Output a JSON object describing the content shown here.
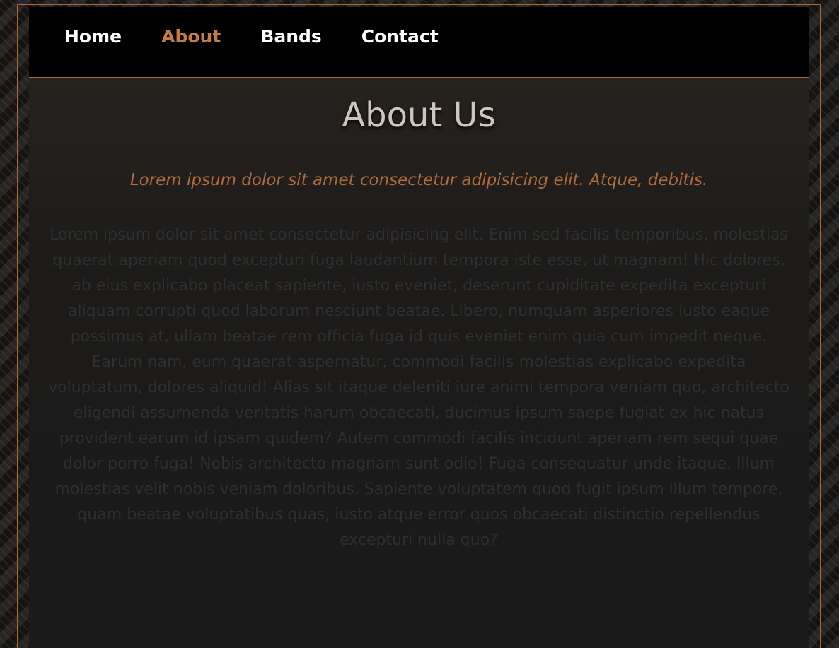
{
  "nav": {
    "items": [
      {
        "label": "Home",
        "active": false
      },
      {
        "label": "About",
        "active": true
      },
      {
        "label": "Bands",
        "active": false
      },
      {
        "label": "Contact",
        "active": false
      }
    ]
  },
  "main": {
    "title": "About Us",
    "lead": "Lorem ipsum dolor sit amet consectetur adipisicing elit. Atque, debitis.",
    "body": "Lorem ipsum dolor sit amet consectetur adipisicing elit. Enim sed facilis temporibus, molestias quaerat aperiam quod excepturi fuga laudantium tempora iste esse, ut magnam! Hic dolores, ab eius explicabo placeat sapiente, iusto eveniet, deserunt cupiditate expedita excepturi aliquam corrupti quod laborum nesciunt beatae. Libero, numquam asperiores iusto eaque possimus at, ullam beatae rem officia fuga id quis eveniet enim quia cum impedit neque. Earum nam, eum quaerat aspernatur, commodi facilis molestias explicabo expedita voluptatum, dolores aliquid! Alias sit itaque deleniti iure animi tempora veniam quo, architecto eligendi assumenda veritatis harum obcaecati, ducimus ipsum saepe fugiat ex hic natus provident earum id ipsam quidem? Autem commodi facilis incidunt aperiam rem sequi quae dolor porro fuga! Nobis architecto magnam sunt odio! Fuga consequatur unde itaque. Illum molestias velit nobis veniam doloribus. Sapiente voluptatem quod fugit ipsum illum tempore, quam beatae voluptatibus quas, iusto atque error quos obcaecati distinctio repellendus excepturi nulla quo?"
  },
  "colors": {
    "accent": "#c27d44",
    "nav_background": "#000000",
    "content_background": "#1a1a1a",
    "title": "#cfc5bd",
    "lead": "#b06b3c",
    "body_text": "#2f2f2f"
  }
}
